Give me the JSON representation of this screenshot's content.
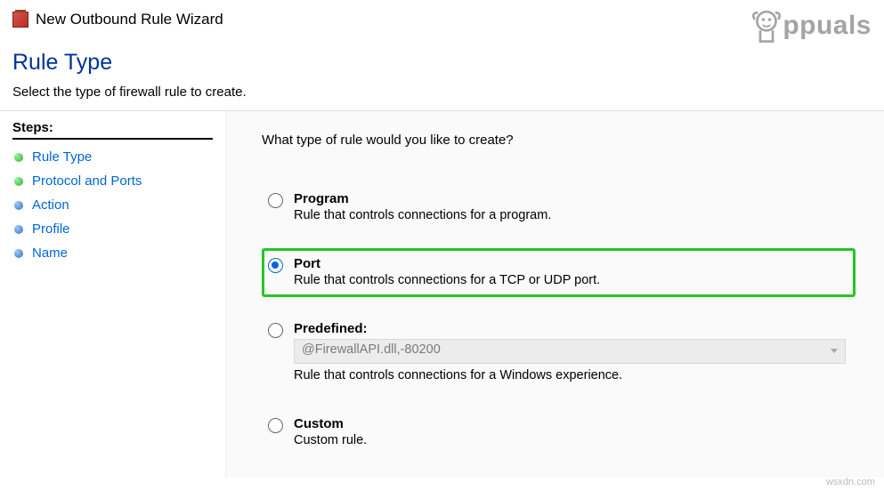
{
  "titlebar": {
    "title": "New Outbound Rule Wizard"
  },
  "header": {
    "title": "Rule Type",
    "subtitle": "Select the type of firewall rule to create."
  },
  "sidebar": {
    "steps_label": "Steps:",
    "items": [
      {
        "label": "Rule Type",
        "bullet": "green"
      },
      {
        "label": "Protocol and Ports",
        "bullet": "green"
      },
      {
        "label": "Action",
        "bullet": "blue"
      },
      {
        "label": "Profile",
        "bullet": "blue"
      },
      {
        "label": "Name",
        "bullet": "blue"
      }
    ]
  },
  "main": {
    "question": "What type of rule would you like to create?",
    "options": {
      "program": {
        "title": "Program",
        "desc": "Rule that controls connections for a program."
      },
      "port": {
        "title": "Port",
        "desc": "Rule that controls connections for a TCP or UDP port."
      },
      "predefined": {
        "title": "Predefined:",
        "combo_value": "@FirewallAPI.dll,-80200",
        "desc": "Rule that controls connections for a Windows experience."
      },
      "custom": {
        "title": "Custom",
        "desc": "Custom rule."
      }
    }
  },
  "watermark": {
    "text": "ppuals"
  },
  "footer": {
    "credit": "wsxdn.com"
  }
}
